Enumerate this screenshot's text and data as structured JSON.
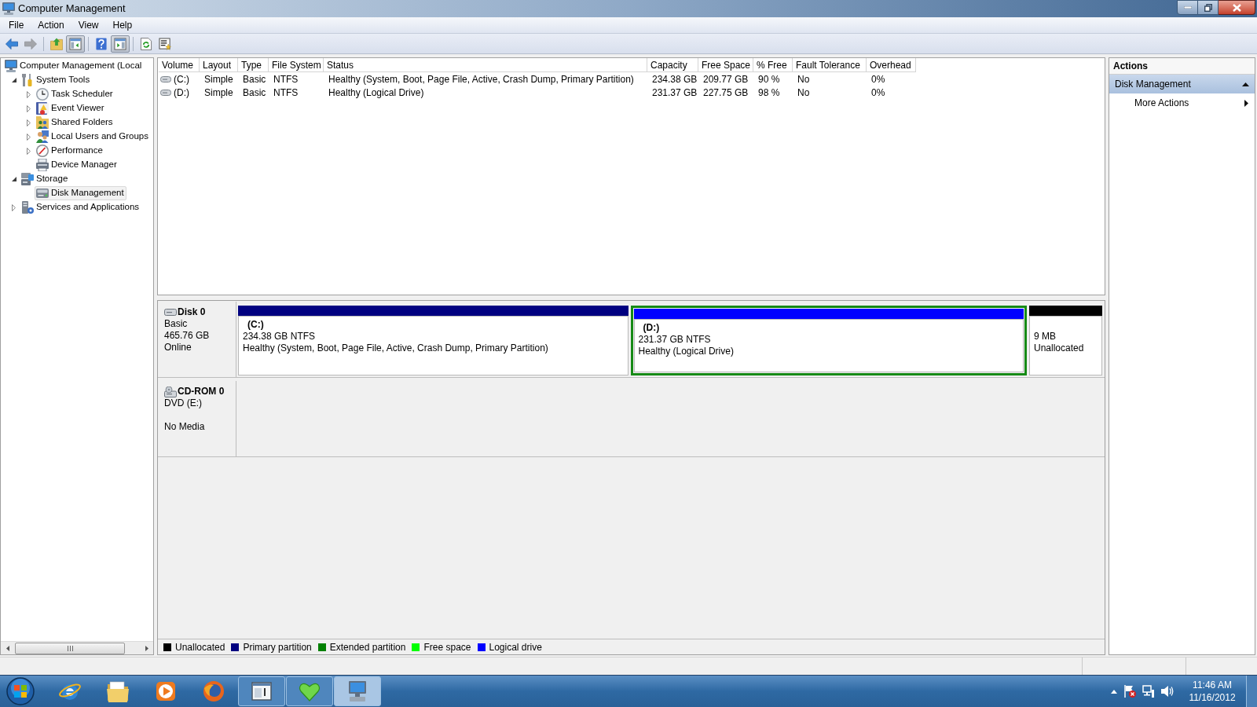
{
  "window": {
    "title": "Computer Management"
  },
  "menu": [
    "File",
    "Action",
    "View",
    "Help"
  ],
  "toolbar_groups": [
    [
      {
        "kind": "back",
        "pressed": false,
        "disabled": false
      },
      {
        "kind": "forward",
        "pressed": false,
        "disabled": true
      }
    ],
    [
      {
        "kind": "up",
        "pressed": false,
        "disabled": false
      },
      {
        "kind": "console",
        "pressed": true,
        "disabled": false
      }
    ],
    [
      {
        "kind": "help",
        "pressed": false,
        "disabled": false
      },
      {
        "kind": "actionpane",
        "pressed": true,
        "disabled": false
      }
    ],
    [
      {
        "kind": "export",
        "pressed": false,
        "disabled": false
      },
      {
        "kind": "properties",
        "pressed": false,
        "disabled": false
      }
    ]
  ],
  "tree": {
    "label": "Computer Management (Local",
    "kind": "computer",
    "selected": false,
    "children": [
      {
        "label": "System Tools",
        "kind": "tools",
        "expanded": true,
        "selected": false,
        "children": [
          {
            "label": "Task Scheduler",
            "kind": "clock",
            "expanded": false,
            "selected": false
          },
          {
            "label": "Event Viewer",
            "kind": "log",
            "expanded": false,
            "selected": false
          },
          {
            "label": "Shared Folders",
            "kind": "share",
            "expanded": false,
            "selected": false
          },
          {
            "label": "Local Users and Groups",
            "kind": "users",
            "expanded": false,
            "selected": false
          },
          {
            "label": "Performance",
            "kind": "gauge",
            "expanded": false,
            "selected": false
          },
          {
            "label": "Device Manager",
            "kind": "devices",
            "selected": false
          }
        ]
      },
      {
        "label": "Storage",
        "kind": "storage",
        "expanded": true,
        "selected": false,
        "children": [
          {
            "label": "Disk Management",
            "kind": "disk",
            "selected": true
          }
        ]
      },
      {
        "label": "Services and Applications",
        "kind": "services",
        "expanded": false,
        "selected": false
      }
    ]
  },
  "volumes_table": {
    "columns": [
      "Volume",
      "Layout",
      "Type",
      "File System",
      "Status",
      "Capacity",
      "Free Space",
      "% Free",
      "Fault Tolerance",
      "Overhead"
    ],
    "rows": [
      [
        "(C:)",
        "Simple",
        "Basic",
        "NTFS",
        "Healthy (System, Boot, Page File, Active, Crash Dump, Primary Partition)",
        "234.38 GB",
        "209.77 GB",
        "90 %",
        "No",
        "0%"
      ],
      [
        "(D:)",
        "Simple",
        "Basic",
        "NTFS",
        "Healthy (Logical Drive)",
        "231.37 GB",
        "227.75 GB",
        "98 %",
        "No",
        "0%"
      ]
    ]
  },
  "disks": [
    {
      "kind": "disk",
      "name": "Disk 0",
      "type": "Basic",
      "size": "465.76 GB",
      "status": "Online",
      "partitions": [
        {
          "label": "(C:)",
          "size": "234.38 GB NTFS",
          "status": "Healthy (System, Boot, Page File, Active, Crash Dump, Primary Partition)",
          "color": "#000080",
          "selected": false
        },
        {
          "label": "(D:)",
          "size": "231.37 GB NTFS",
          "status": "Healthy (Logical Drive)",
          "color": "#0000ff",
          "selected": true
        },
        {
          "size": "9 MB",
          "status": "Unallocated",
          "color": "#000000",
          "selected": false
        }
      ]
    },
    {
      "kind": "cdrom",
      "name": "CD-ROM 0",
      "type": "DVD (E:)",
      "status": "No Media"
    }
  ],
  "legend": [
    {
      "label": "Unallocated",
      "color": "#000000"
    },
    {
      "label": "Primary partition",
      "color": "#000080"
    },
    {
      "label": "Extended partition",
      "color": "#008000"
    },
    {
      "label": "Free space",
      "color": "#00ff00"
    },
    {
      "label": "Logical drive",
      "color": "#0000ff"
    }
  ],
  "actions": {
    "title": "Actions",
    "sections": [
      {
        "label": "Disk Management",
        "expanded": true,
        "items": [
          "More Actions"
        ]
      }
    ]
  },
  "taskbar": {
    "apps": [
      {
        "kind": "globe",
        "running": false,
        "active": false
      },
      {
        "kind": "folder",
        "running": false,
        "active": false
      },
      {
        "kind": "media",
        "running": false,
        "active": false
      },
      {
        "kind": "fox",
        "running": false,
        "active": false
      },
      {
        "kind": "window",
        "running": true,
        "active": false
      },
      {
        "kind": "heart",
        "running": true,
        "active": false
      },
      {
        "kind": "computer",
        "running": true,
        "active": true
      }
    ],
    "time": "11:46 AM",
    "date": "11/16/2012"
  }
}
